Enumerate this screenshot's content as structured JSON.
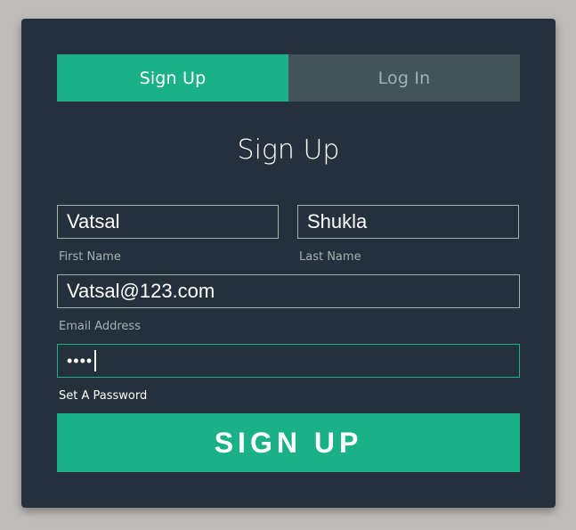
{
  "tabs": {
    "signup_label": "Sign Up",
    "login_label": "Log In"
  },
  "form": {
    "heading": "Sign Up",
    "first_name": {
      "value": "Vatsal",
      "label": "First Name"
    },
    "last_name": {
      "value": "Shukla",
      "label": "Last Name"
    },
    "email": {
      "value": "Vatsal@123.com",
      "label": "Email Address"
    },
    "password": {
      "masked_value": "••••",
      "label": "Set A Password"
    },
    "submit_label": "SIGN UP"
  },
  "colors": {
    "accent": "#1ab188",
    "card_background": "#24303c",
    "inactive_tab": "#435359",
    "page_background": "#c0bcb9"
  }
}
